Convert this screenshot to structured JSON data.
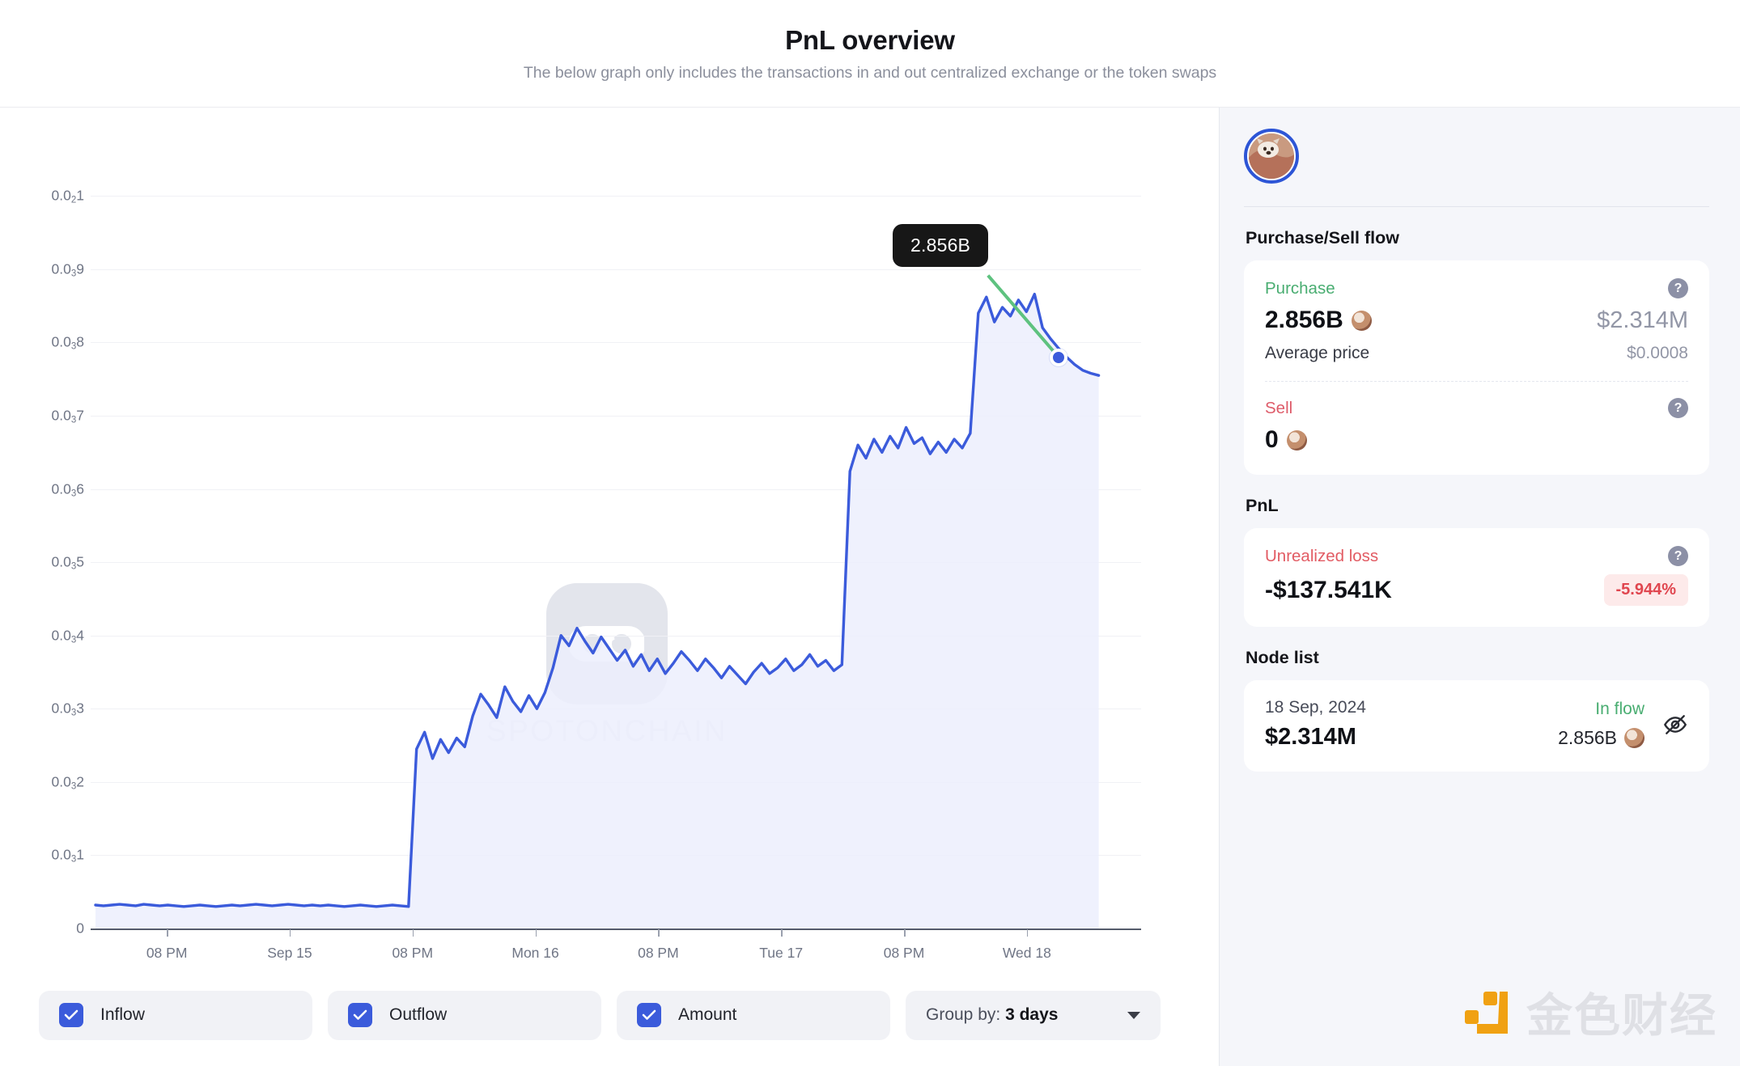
{
  "header": {
    "title": "PnL overview",
    "subtitle": "The below graph only includes the transactions in and out centralized exchange or the token swaps"
  },
  "chart_data": {
    "type": "area",
    "title": "PnL overview",
    "xlabel": "",
    "ylabel": "",
    "grid": true,
    "legend_position": "bottom",
    "ytick_labels": [
      "0.0₂1",
      "0.0₃9",
      "0.0₃8",
      "0.0₃7",
      "0.0₃6",
      "0.0₃5",
      "0.0₃4",
      "0.0₃3",
      "0.0₃2",
      "0.0₃1",
      "0"
    ],
    "ytick_values": [
      0.001,
      0.0009,
      0.0008,
      0.0007,
      0.0006,
      0.0005,
      0.0004,
      0.0003,
      0.0002,
      0.0001,
      0
    ],
    "ylim": [
      0,
      0.00105
    ],
    "xtick_labels": [
      "08 PM",
      "Sep 15",
      "08 PM",
      "Mon 16",
      "08 PM",
      "Tue 17",
      "08 PM",
      "Wed 18"
    ],
    "series": [
      {
        "name": "Amount",
        "color": "#3b5bdb",
        "fill": "#eceffd",
        "values": [
          3.2e-05,
          3.1e-05,
          3.2e-05,
          3.3e-05,
          3.2e-05,
          3.1e-05,
          3.3e-05,
          3.2e-05,
          3.1e-05,
          3.2e-05,
          3.1e-05,
          3e-05,
          3.1e-05,
          3.2e-05,
          3.1e-05,
          3e-05,
          3.1e-05,
          3.2e-05,
          3.1e-05,
          3.2e-05,
          3.3e-05,
          3.2e-05,
          3.1e-05,
          3.2e-05,
          3.3e-05,
          3.2e-05,
          3.1e-05,
          3.2e-05,
          3.1e-05,
          3.2e-05,
          3.1e-05,
          3e-05,
          3.1e-05,
          3.2e-05,
          3.1e-05,
          3e-05,
          3.1e-05,
          3.2e-05,
          3.1e-05,
          3e-05,
          0.000245,
          0.000268,
          0.000232,
          0.000258,
          0.00024,
          0.00026,
          0.000248,
          0.00029,
          0.00032,
          0.000305,
          0.000288,
          0.00033,
          0.00031,
          0.000296,
          0.000318,
          0.0003,
          0.000322,
          0.000356,
          0.0004,
          0.000386,
          0.00041,
          0.000392,
          0.000376,
          0.000398,
          0.000382,
          0.000366,
          0.00038,
          0.000358,
          0.000374,
          0.000352,
          0.000368,
          0.000348,
          0.000362,
          0.000378,
          0.000366,
          0.000352,
          0.000368,
          0.000356,
          0.000342,
          0.000358,
          0.000346,
          0.000334,
          0.00035,
          0.000362,
          0.000348,
          0.000356,
          0.000368,
          0.000352,
          0.00036,
          0.000374,
          0.000358,
          0.000366,
          0.000352,
          0.00036,
          0.000624,
          0.00066,
          0.000642,
          0.000668,
          0.00065,
          0.000672,
          0.000656,
          0.000684,
          0.000662,
          0.00067,
          0.000648,
          0.000664,
          0.00065,
          0.000668,
          0.000656,
          0.000676,
          0.00084,
          0.000862,
          0.000828,
          0.000848,
          0.000836,
          0.000858,
          0.000842,
          0.000866,
          0.00082,
          0.000805,
          0.000792,
          0.00078,
          0.00077,
          0.000762,
          0.000758,
          0.000755
        ]
      }
    ],
    "annotation": {
      "label": "2.856B",
      "point_value": 0.00078
    }
  },
  "tooltip": {
    "label": "2.856B"
  },
  "watermark": {
    "text": "SPOTONCHAIN",
    "logo_icon": "spotonchain-logo-icon"
  },
  "controls": {
    "inflow": {
      "label": "Inflow",
      "checked": true
    },
    "outflow": {
      "label": "Outflow",
      "checked": true
    },
    "amount": {
      "label": "Amount",
      "checked": true
    },
    "group_by": {
      "prefix": "Group by:",
      "value": "3 days"
    }
  },
  "sidebar": {
    "purchase_sell": {
      "section_title": "Purchase/Sell flow",
      "purchase_label": "Purchase",
      "purchase_amount": "2.856B",
      "purchase_usd": "$2.314M",
      "avg_price_label": "Average price",
      "avg_price_value": "$0.0008",
      "sell_label": "Sell",
      "sell_amount": "0",
      "help_icon": "?"
    },
    "pnl": {
      "section_title": "PnL",
      "loss_label": "Unrealized loss",
      "loss_value": "-$137.541K",
      "loss_percent": "-5.944%",
      "help_icon": "?"
    },
    "node_list": {
      "section_title": "Node list",
      "rows": [
        {
          "date": "18 Sep, 2024",
          "usd": "$2.314M",
          "flow": "In flow",
          "amount": "2.856B"
        }
      ]
    }
  },
  "brand": {
    "name_cn": "金色财经"
  },
  "colors": {
    "accent_blue": "#3b5bdb",
    "green": "#49ad71",
    "red": "#e0464f",
    "tooltip_bg": "#171717",
    "leader_green": "#5ec27f",
    "brand_orange": "#f0a112"
  }
}
